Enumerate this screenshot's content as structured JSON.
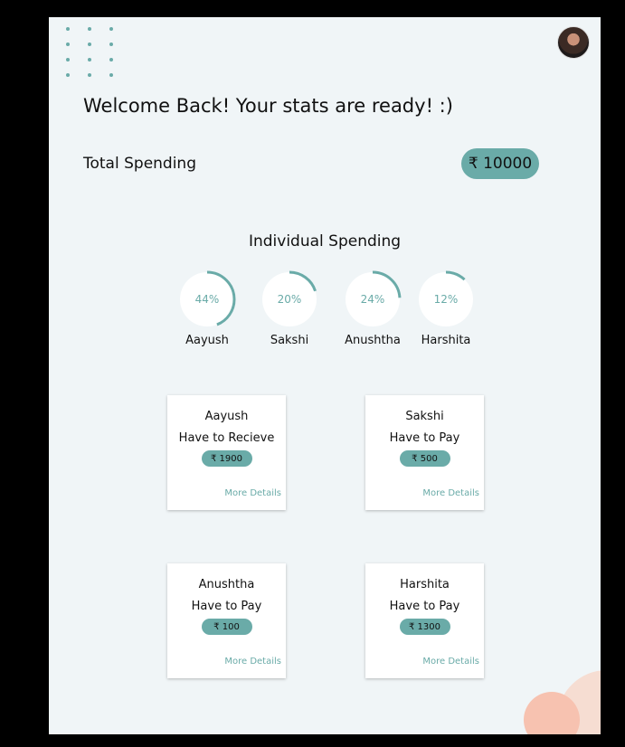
{
  "header": {
    "title": "Welcome Back! Your stats are ready! :)",
    "avatar_icon": "user-avatar"
  },
  "total": {
    "label": "Total Spending",
    "amount": "₹ 10000"
  },
  "individual": {
    "title": "Individual Spending",
    "people": [
      {
        "name": "Aayush",
        "pct_label": "44%",
        "pct": 44
      },
      {
        "name": "Sakshi",
        "pct_label": "20%",
        "pct": 20
      },
      {
        "name": "Anushtha",
        "pct_label": "24%",
        "pct": 24
      },
      {
        "name": "Harshita",
        "pct_label": "12%",
        "pct": 12
      }
    ]
  },
  "cards": [
    {
      "name": "Aayush",
      "status": "Have to Recieve",
      "amount": "₹ 1900",
      "link": "More Details"
    },
    {
      "name": "Sakshi",
      "status": "Have to Pay",
      "amount": "₹ 500",
      "link": "More Details"
    },
    {
      "name": "Anushtha",
      "status": "Have to Pay",
      "amount": "₹ 100",
      "link": "More Details"
    },
    {
      "name": "Harshita",
      "status": "Have to Pay",
      "amount": "₹ 1300",
      "link": "More Details"
    }
  ],
  "colors": {
    "accent": "#6aaba8",
    "background": "#f0f5f7",
    "blob_light": "#f6ddd2",
    "blob_dark": "#f7c2b0"
  }
}
